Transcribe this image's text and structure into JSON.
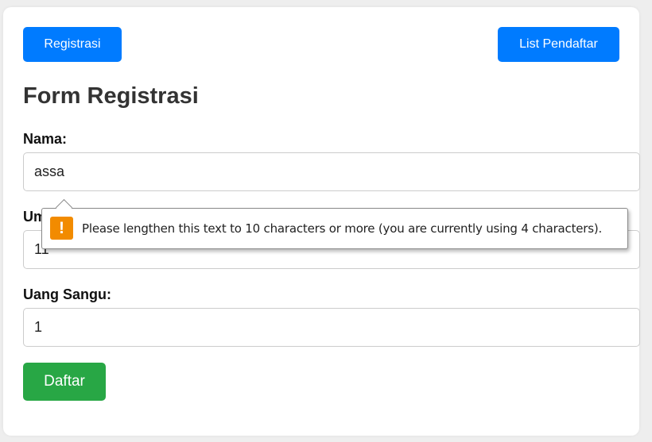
{
  "nav": {
    "registrasi_label": "Registrasi",
    "list_label": "List Pendaftar"
  },
  "form": {
    "title": "Form Registrasi",
    "nama_label": "Nama:",
    "nama_value": "assa",
    "umur_label": "Umur:",
    "umur_value": "11",
    "uang_label": "Uang Sangu:",
    "uang_value": "1",
    "submit_label": "Daftar"
  },
  "validation_tooltip": {
    "icon": "warning-icon",
    "icon_glyph": "!",
    "message": "Please lengthen this text to 10 characters or more (you are currently using 4 characters)."
  },
  "colors": {
    "primary": "#007bff",
    "success": "#28a745",
    "warning": "#f28b00"
  }
}
